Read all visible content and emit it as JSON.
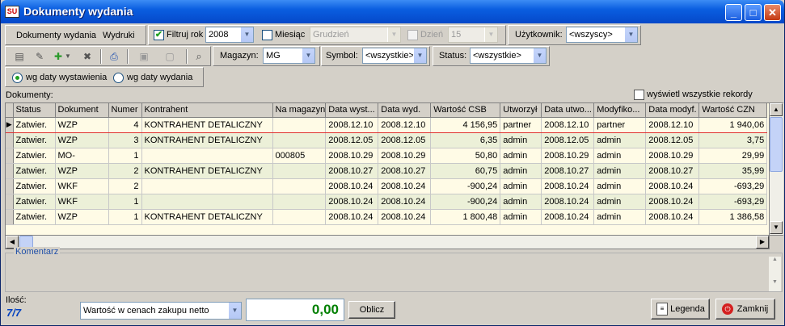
{
  "window": {
    "title": "Dokumenty wydania",
    "icon_text": "SU"
  },
  "menu": {
    "documents": "Dokumenty wydania",
    "prints": "Wydruki"
  },
  "filters": {
    "year_filter_label": "Filtruj rok",
    "year_filter_checked": true,
    "year": "2008",
    "month_label": "Miesiąc",
    "month_checked": false,
    "month": "Grudzień",
    "day_label": "Dzień",
    "day_checked": false,
    "day": "15",
    "user_label": "Użytkownik:",
    "user": "<wszyscy>",
    "warehouse_label": "Magazyn:",
    "warehouse": "MG",
    "symbol_label": "Symbol:",
    "symbol": "<wszystkie>",
    "status_label": "Status:",
    "status": "<wszystkie>"
  },
  "date_mode": {
    "by_issue": "wg daty wystawienia",
    "by_release": "wg daty wydania",
    "selected": "by_issue"
  },
  "list": {
    "label": "Dokumenty:",
    "show_all_label": "wyświetl wszystkie rekordy",
    "show_all_checked": false
  },
  "columns": [
    "Status",
    "Dokument",
    "Numer",
    "Kontrahent",
    "Na magazyn",
    "Data wyst...",
    "Data wyd.",
    "Wartość CSB",
    "Utworzył",
    "Data utwo...",
    "Modyfiko...",
    "Data modyf.",
    "Wartość CZN"
  ],
  "rows": [
    [
      "Zatwier.",
      "WZP",
      "4",
      "KONTRAHENT DETALICZNY",
      "",
      "2008.12.10",
      "2008.12.10",
      "4 156,95",
      "partner",
      "2008.12.10",
      "partner",
      "2008.12.10",
      "1 940,06"
    ],
    [
      "Zatwier.",
      "WZP",
      "3",
      "KONTRAHENT DETALICZNY",
      "",
      "2008.12.05",
      "2008.12.05",
      "6,35",
      "admin",
      "2008.12.05",
      "admin",
      "2008.12.05",
      "3,75"
    ],
    [
      "Zatwier.",
      "MO-",
      "1",
      "",
      "000805",
      "2008.10.29",
      "2008.10.29",
      "50,80",
      "admin",
      "2008.10.29",
      "admin",
      "2008.10.29",
      "29,99"
    ],
    [
      "Zatwier.",
      "WZP",
      "2",
      "KONTRAHENT DETALICZNY",
      "",
      "2008.10.27",
      "2008.10.27",
      "60,75",
      "admin",
      "2008.10.27",
      "admin",
      "2008.10.27",
      "35,99"
    ],
    [
      "Zatwier.",
      "WKF",
      "2",
      "",
      "",
      "2008.10.24",
      "2008.10.24",
      "-900,24",
      "admin",
      "2008.10.24",
      "admin",
      "2008.10.24",
      "-693,29"
    ],
    [
      "Zatwier.",
      "WKF",
      "1",
      "",
      "",
      "2008.10.24",
      "2008.10.24",
      "-900,24",
      "admin",
      "2008.10.24",
      "admin",
      "2008.10.24",
      "-693,29"
    ],
    [
      "Zatwier.",
      "WZP",
      "1",
      "KONTRAHENT DETALICZNY",
      "",
      "2008.10.24",
      "2008.10.24",
      "1 800,48",
      "admin",
      "2008.10.24",
      "admin",
      "2008.10.24",
      "1 386,58"
    ]
  ],
  "comment": {
    "label": "Komentarz"
  },
  "footer": {
    "count_label": "Ilość:",
    "count": "7/7",
    "value_type": "Wartość w cenach zakupu netto",
    "value": "0,00",
    "calc_button": "Oblicz",
    "legend_button": "Legenda",
    "close_button": "Zamknij"
  },
  "colors": {
    "title_bar": "#0548c9",
    "value_green": "#008000",
    "count_blue": "#0040c0",
    "row_alt": "#ecf0d8",
    "row_base": "#fffbe6",
    "accent_green": "#21a121"
  }
}
